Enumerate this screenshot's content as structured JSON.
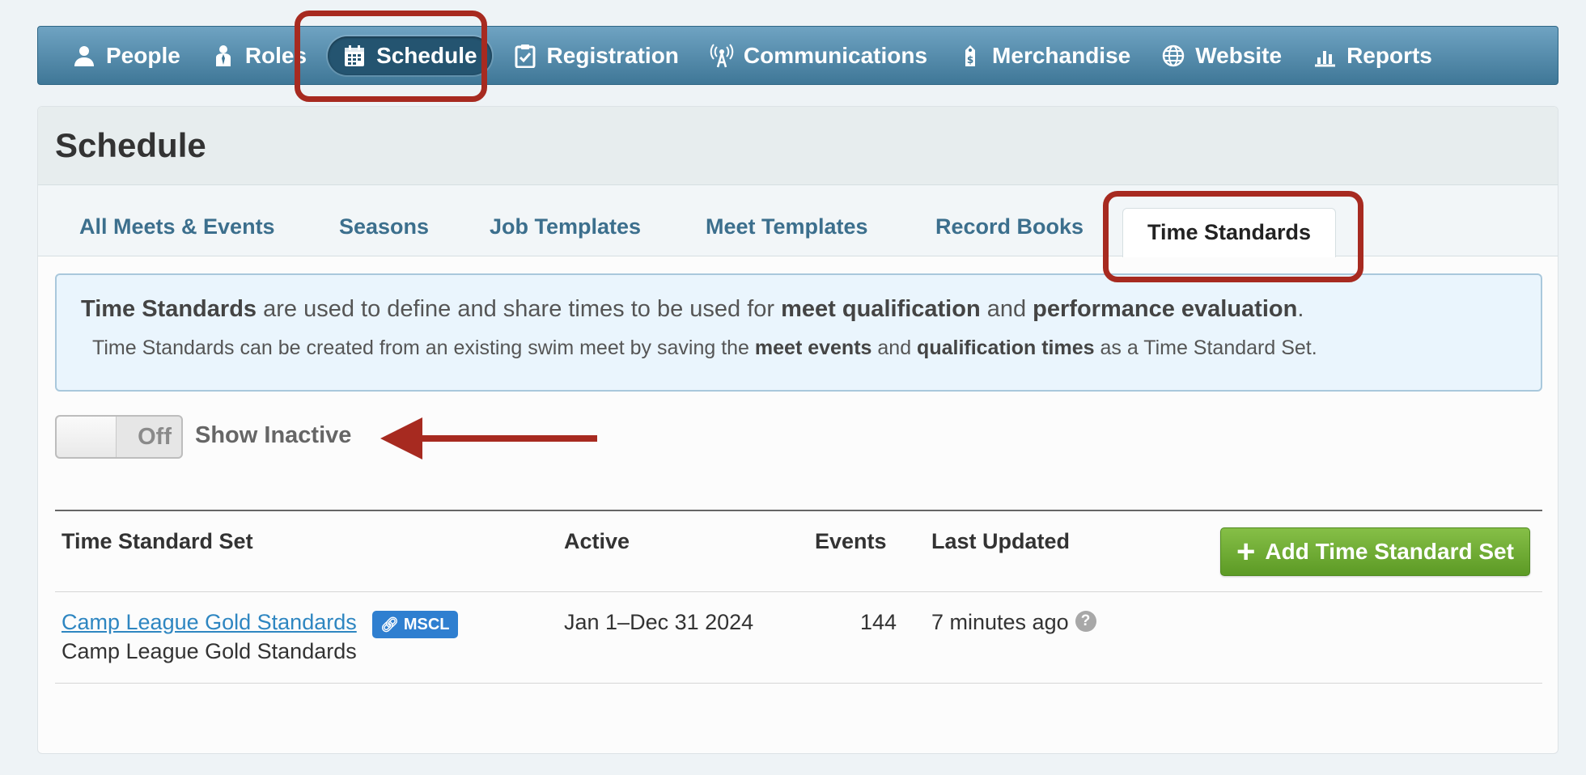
{
  "nav": {
    "items": [
      {
        "label": "People",
        "icon": "person-icon"
      },
      {
        "label": "Roles",
        "icon": "role-icon"
      },
      {
        "label": "Schedule",
        "icon": "calendar-icon"
      },
      {
        "label": "Registration",
        "icon": "clipboard-check-icon"
      },
      {
        "label": "Communications",
        "icon": "antenna-icon"
      },
      {
        "label": "Merchandise",
        "icon": "price-tag-icon"
      },
      {
        "label": "Website",
        "icon": "globe-icon"
      },
      {
        "label": "Reports",
        "icon": "bar-chart-icon"
      }
    ],
    "active": "Schedule"
  },
  "page": {
    "title": "Schedule"
  },
  "tabs": {
    "items": [
      "All Meets & Events",
      "Seasons",
      "Job Templates",
      "Meet Templates",
      "Record Books",
      "Time Standards"
    ],
    "active": "Time Standards"
  },
  "info": {
    "line1": {
      "b1": "Time Standards",
      "t1": " are used to define and share times to be used for ",
      "b2": "meet qualification",
      "t2": " and ",
      "b3": "performance evaluation",
      "t3": "."
    },
    "line2": {
      "t1": "Time Standards can be created from an existing swim meet by saving the ",
      "b1": "meet events",
      "t2": " and ",
      "b2": "qualification times",
      "t3": " as a Time Standard Set."
    }
  },
  "toggle": {
    "state": "Off",
    "label": "Show Inactive"
  },
  "table": {
    "headers": {
      "set": "Time Standard Set",
      "active": "Active",
      "events": "Events",
      "updated": "Last Updated"
    },
    "add_button": "Add Time Standard Set",
    "rows": [
      {
        "name": "Camp League Gold Standards",
        "subtitle": "Camp League Gold Standards",
        "badge": "MSCL",
        "active": "Jan 1–Dec 31 2024",
        "events": "144",
        "updated": "7 minutes ago"
      }
    ]
  },
  "colors": {
    "nav_gradient_top": "#6fa3c2",
    "nav_gradient_bottom": "#3f7797",
    "highlight": "#a72a20",
    "add_button": "#5c9a25",
    "link": "#2e86c1",
    "badge": "#2f7fd0"
  }
}
